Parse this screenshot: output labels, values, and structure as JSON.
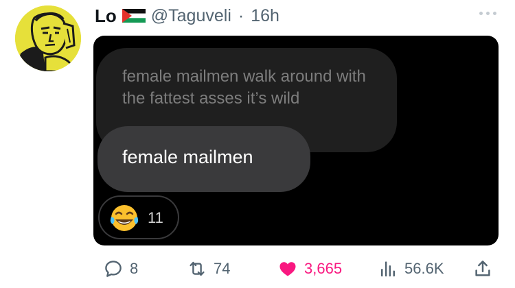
{
  "tweet": {
    "author_name": "Lo",
    "handle": "@Taguveli",
    "separator": "·",
    "time": "16h"
  },
  "media": {
    "quoted_message": "female mailmen walk around with the fattest asses it’s wild",
    "reply_message": "female mailmen",
    "reaction": {
      "emoji": "tears-of-joy-emoji",
      "count": "11"
    }
  },
  "actions": {
    "replies": "8",
    "retweets": "74",
    "likes": "3,665",
    "views": "56.6K"
  },
  "colors": {
    "like": "#f91880",
    "muted": "#536471",
    "media_bg": "#000000"
  },
  "icons": [
    "flag-icon",
    "more-icon",
    "reply-icon",
    "retweet-icon",
    "like-icon",
    "views-icon",
    "share-icon"
  ]
}
